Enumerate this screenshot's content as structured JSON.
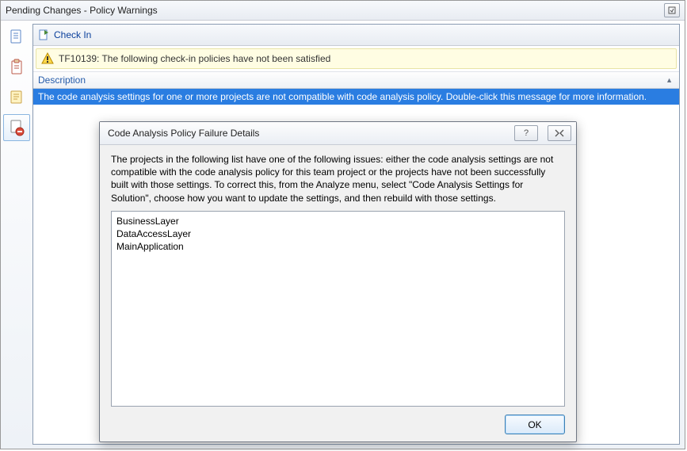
{
  "window": {
    "title": "Pending Changes - Policy Warnings"
  },
  "toolbar": {
    "checkin_label": "Check In"
  },
  "warning": {
    "text": "TF10139: The following check-in policies have not been satisfied"
  },
  "grid": {
    "header": "Description",
    "selected_row": "The code analysis settings for one or more projects are not compatible with code analysis policy. Double-click this message for more information."
  },
  "dialog": {
    "title": "Code Analysis Policy Failure Details",
    "body": "The projects in the following list have one of the following issues: either the code analysis settings are not compatible with the code analysis policy for this team project or the projects have not been successfully built with those settings. To correct this, from the Analyze menu, select \"Code Analysis Settings for Solution\", choose how you want to update the settings, and then rebuild with those settings.",
    "items": [
      "BusinessLayer",
      "DataAccessLayer",
      "MainApplication"
    ],
    "ok_label": "OK"
  }
}
